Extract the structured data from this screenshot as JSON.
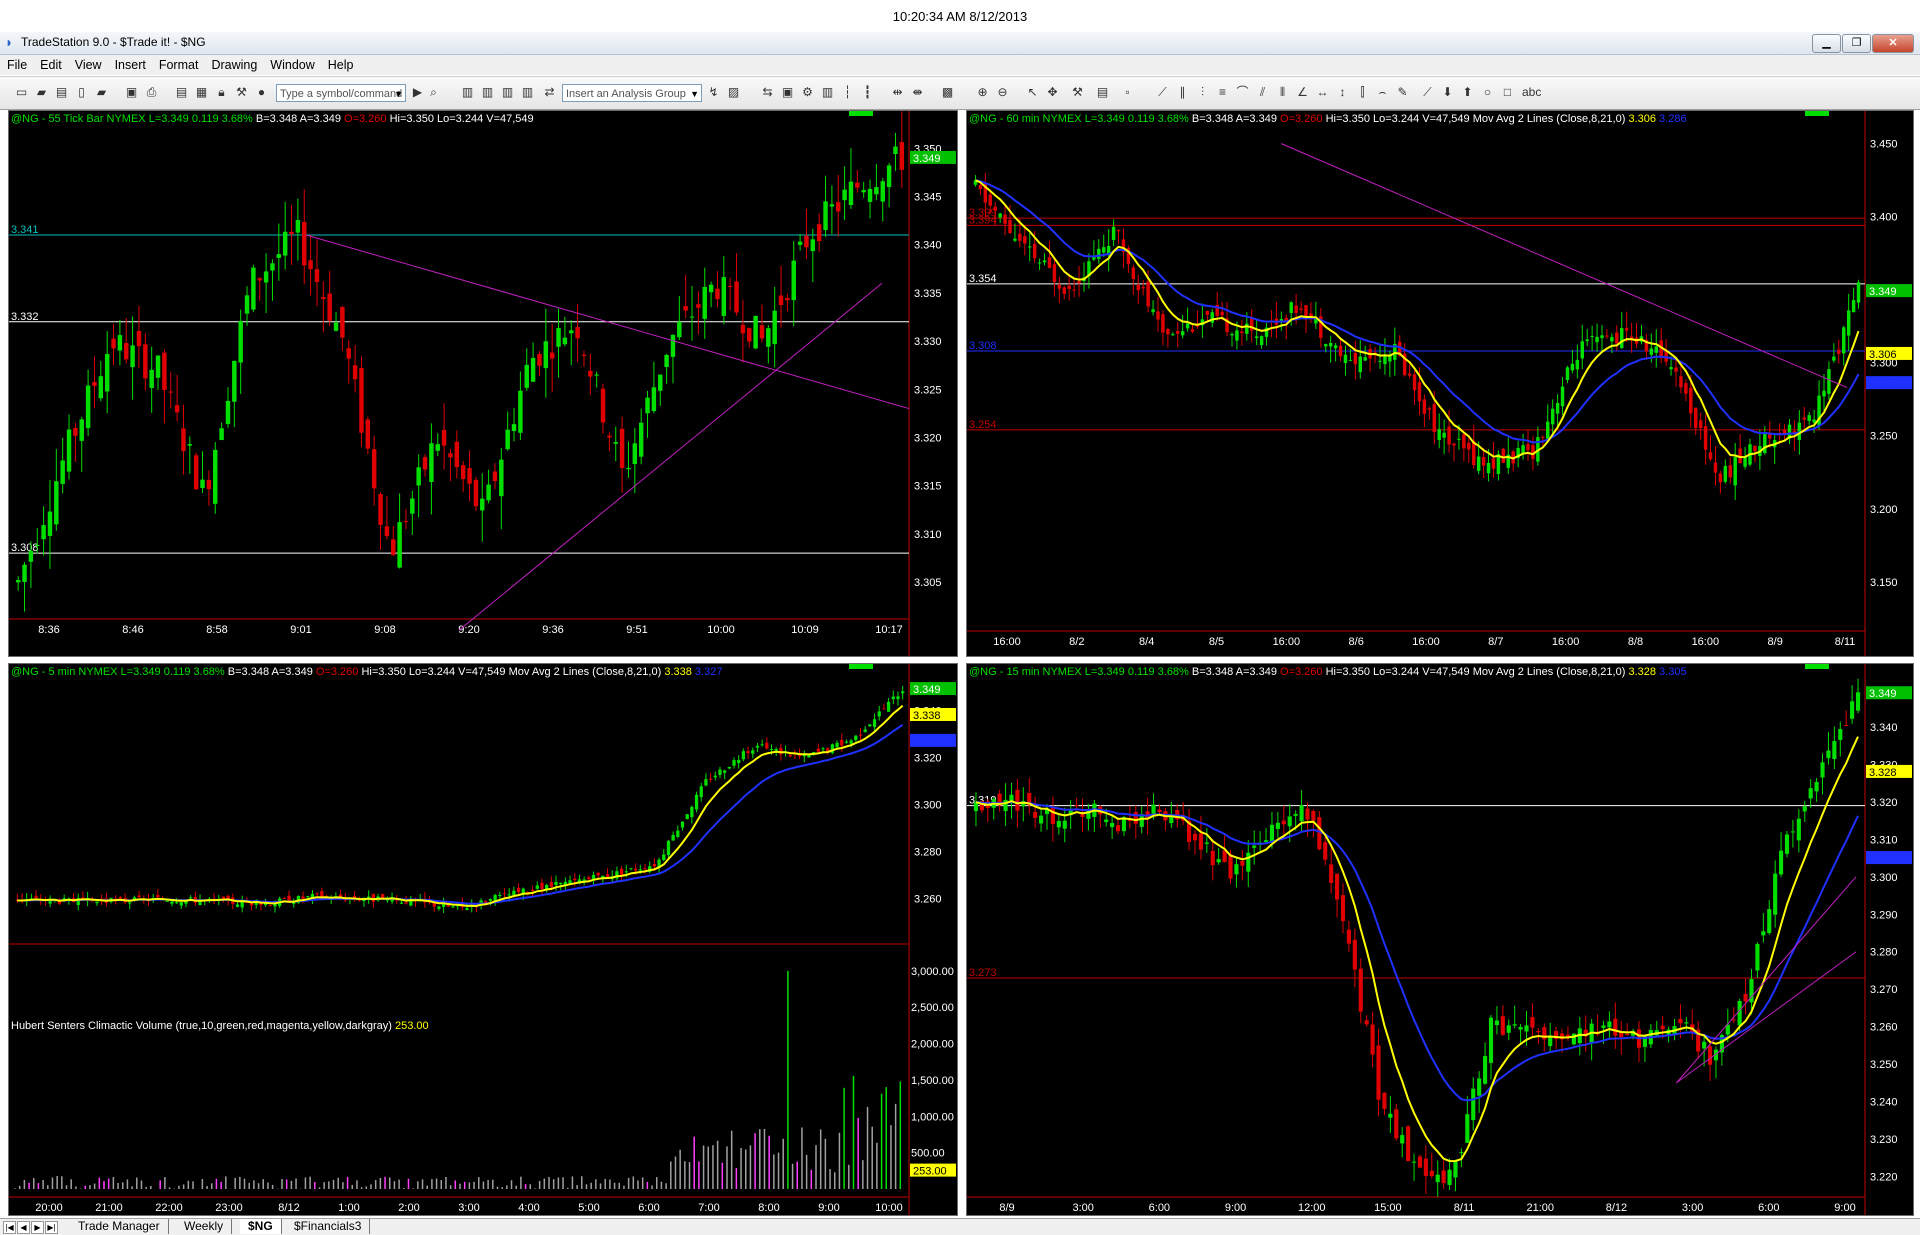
{
  "clock": "10:20:34 AM 8/12/2013",
  "window_title": "TradeStation 9.0 - $Trade it! - $NG",
  "menu": [
    "File",
    "Edit",
    "View",
    "Insert",
    "Format",
    "Drawing",
    "Window",
    "Help"
  ],
  "toolbar": {
    "symbol_placeholder": "Type a symbol/command",
    "analysis_placeholder": "Insert an Analysis Group"
  },
  "charts": {
    "tl": {
      "sym": "@NG - 55 Tick Bar",
      "exch": "NYMEX",
      "last": "L=3.349",
      "chg": "0.119",
      "pct": "3.68%",
      "bid": "B=3.348",
      "ask": "A=3.349",
      "open": "O=3.260",
      "hi": "Hi=3.350",
      "lo": "Lo=3.244",
      "vol": "V=47,549",
      "price_ticks": [
        "3.350",
        "3.345",
        "3.340",
        "3.335",
        "3.330",
        "3.325",
        "3.320",
        "3.315",
        "3.310",
        "3.305"
      ],
      "time_ticks": [
        "8:36",
        "8:46",
        "8:58",
        "9:01",
        "9:08",
        "9:20",
        "9:36",
        "9:51",
        "10:00",
        "10:09",
        "10:17"
      ],
      "last_price": "3.349",
      "level_labels": [
        "3.341",
        "3.332",
        "3.308"
      ]
    },
    "tr": {
      "sym": "@NG - 60 min",
      "exch": "NYMEX",
      "last": "L=3.349",
      "chg": "0.119",
      "pct": "3.68%",
      "bid": "B=3.348",
      "ask": "A=3.349",
      "open": "O=3.260",
      "hi": "Hi=3.350",
      "lo": "Lo=3.244",
      "vol": "V=47,549",
      "study": "Mov Avg 2 Lines (Close,8,21,0)",
      "ma_fast": "3.306",
      "ma_slow": "3.286",
      "price_ticks": [
        "3.450",
        "3.400",
        "3.350",
        "3.300",
        "3.250",
        "3.200",
        "3.150"
      ],
      "time_ticks": [
        "16:00",
        "8/2",
        "8/4",
        "8/5",
        "16:00",
        "8/6",
        "16:00",
        "8/7",
        "16:00",
        "8/8",
        "16:00",
        "8/9",
        "8/11"
      ],
      "last_price": "3.349",
      "level_labels": [
        "3.399",
        "3.394",
        "3.354",
        "3.308",
        "3.254"
      ]
    },
    "bl": {
      "sym": "@NG - 5 min",
      "exch": "NYMEX",
      "last": "L=3.349",
      "chg": "0.119",
      "pct": "3.68%",
      "bid": "B=3.348",
      "ask": "A=3.349",
      "open": "O=3.260",
      "hi": "Hi=3.350",
      "lo": "Lo=3.244",
      "vol": "V=47,549",
      "study": "Mov Avg 2 Lines (Close,8,21,0)",
      "ma_fast": "3.338",
      "ma_slow": "3.327",
      "price_ticks": [
        "3.340",
        "3.320",
        "3.300",
        "3.280",
        "3.260"
      ],
      "time_ticks": [
        "20:00",
        "21:00",
        "22:00",
        "23:00",
        "8/12",
        "1:00",
        "2:00",
        "3:00",
        "4:00",
        "5:00",
        "6:00",
        "7:00",
        "8:00",
        "9:00",
        "10:00"
      ],
      "last_price": "3.349",
      "volume_study": "Hubert Senters Climactic Volume (true,10,green,red,magenta,yellow,darkgray)",
      "volume_value": "253.00",
      "volume_ticks": [
        "3,000.00",
        "2,500.00",
        "2,000.00",
        "1,500.00",
        "1,000.00",
        "500.00"
      ]
    },
    "br": {
      "sym": "@NG - 15 min",
      "exch": "NYMEX",
      "last": "L=3.349",
      "chg": "0.119",
      "pct": "3.68%",
      "bid": "B=3.348",
      "ask": "A=3.349",
      "open": "O=3.260",
      "hi": "Hi=3.350",
      "lo": "Lo=3.244",
      "vol": "V=47,549",
      "study": "Mov Avg 2 Lines (Close,8,21,0)",
      "ma_fast": "3.328",
      "ma_slow": "3.305",
      "price_ticks": [
        "3.340",
        "3.330",
        "3.320",
        "3.310",
        "3.300",
        "3.290",
        "3.280",
        "3.270",
        "3.260",
        "3.250",
        "3.240",
        "3.230",
        "3.220"
      ],
      "time_ticks": [
        "8/9",
        "3:00",
        "6:00",
        "9:00",
        "12:00",
        "15:00",
        "8/11",
        "21:00",
        "8/12",
        "3:00",
        "6:00",
        "9:00"
      ],
      "last_price": "3.349",
      "level_labels": [
        "3.319",
        "3.273"
      ]
    }
  },
  "tabs": [
    "Trade Manager",
    "Weekly",
    "$NG",
    "$Financials3"
  ],
  "active_tab": "$NG",
  "colors": {
    "up": "#00e000",
    "down": "#e00000",
    "ma_fast": "#ffff00",
    "ma_slow": "#2030ff",
    "trend": "#c020c0",
    "level_white": "#ffffff",
    "level_red": "#c00000",
    "level_cyan": "#00c0c0"
  }
}
